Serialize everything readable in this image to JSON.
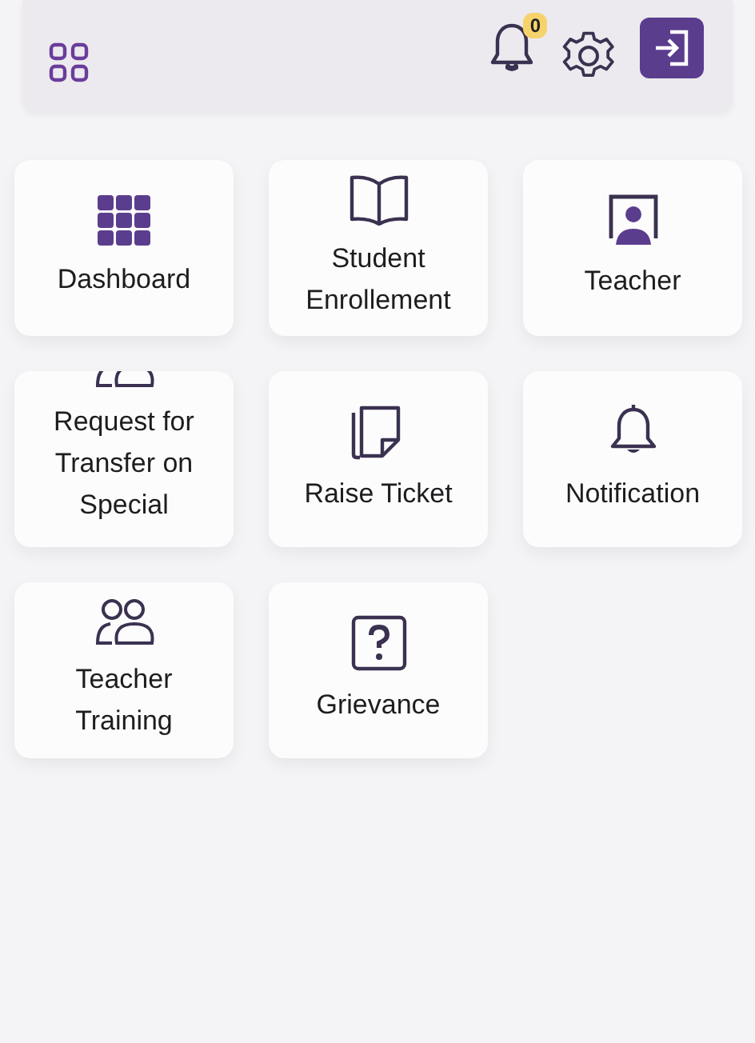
{
  "header": {
    "notification_badge": "0"
  },
  "tiles": [
    {
      "label": "Dashboard"
    },
    {
      "label": "Student Enrollement"
    },
    {
      "label": "Teacher"
    },
    {
      "label": "Request for Transfer on Special"
    },
    {
      "label": "Raise Ticket"
    },
    {
      "label": "Notification"
    },
    {
      "label": "Teacher Training"
    },
    {
      "label": "Grievance"
    }
  ]
}
